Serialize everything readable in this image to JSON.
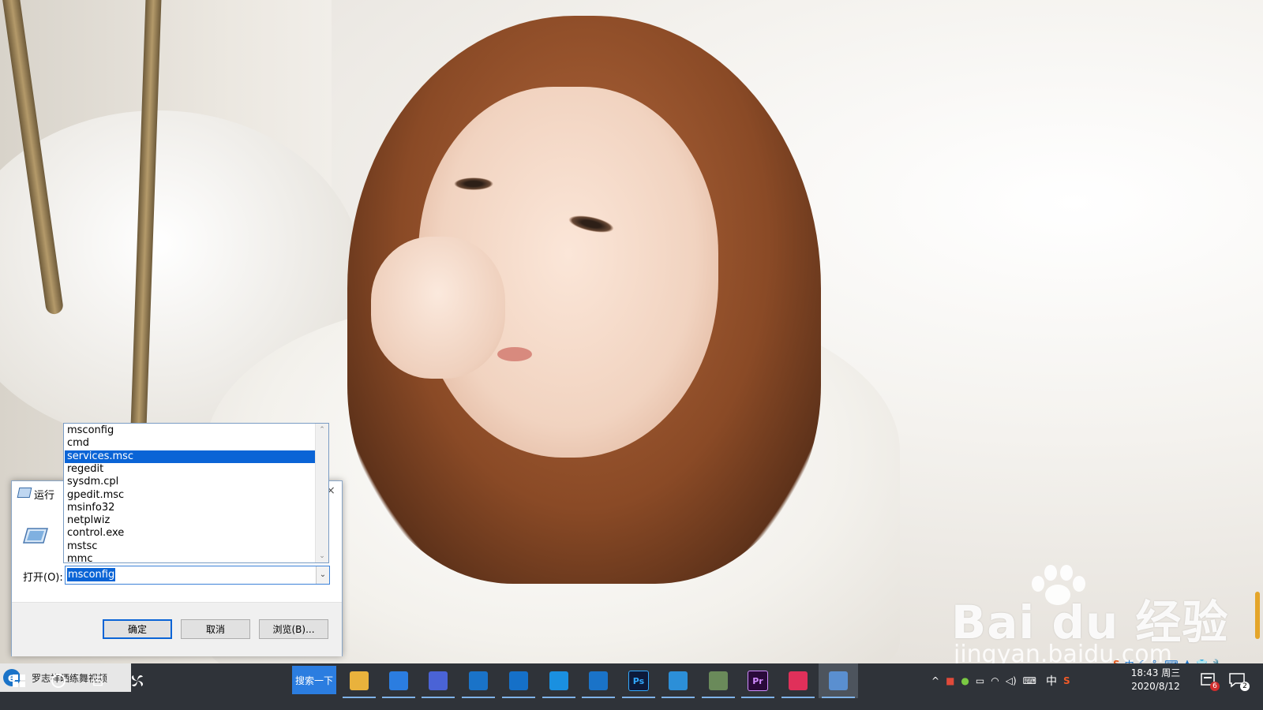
{
  "run_dialog": {
    "title": "运行",
    "close_glyph": "×",
    "open_label": "打开(O):",
    "input_value": "msconfig",
    "combo_arrow": "⌄",
    "ok_label": "确定",
    "cancel_label": "取消",
    "browse_label": "浏览(B)...",
    "icon": "run-icon"
  },
  "history": {
    "items": [
      "msconfig",
      "cmd",
      "services.msc",
      "regedit",
      "sysdm.cpl",
      "gpedit.msc",
      "msinfo32",
      "netplwiz",
      "control.exe",
      "mstsc",
      "mmc"
    ],
    "selected": "services.msc",
    "scroll_up": "⌃",
    "scroll_down": "⌄"
  },
  "taskbar": {
    "search_text": "罗志祥晒练舞视频",
    "search_button": "搜索一下",
    "taskview_glyph": "⊟",
    "apps": [
      {
        "name": "file-explorer-icon",
        "color": "#e9b23c"
      },
      {
        "name": "store-icon",
        "color": "#2b7de0"
      },
      {
        "name": "feishu-icon",
        "color": "#4a63d6"
      },
      {
        "name": "edge-icon",
        "color": "#1a73c8"
      },
      {
        "name": "calendar-app-icon",
        "color": "#1570c8"
      },
      {
        "name": "qq-browser-icon",
        "color": "#1a90e0"
      },
      {
        "name": "upload-app-icon",
        "color": "#1a73c8"
      },
      {
        "name": "photoshop-icon",
        "color": "#0d1a3a"
      },
      {
        "name": "outlook-icon",
        "color": "#2c8fd8"
      },
      {
        "name": "avatar-app-icon",
        "color": "#6a8a5a"
      },
      {
        "name": "premiere-icon",
        "color": "#2a0a3a"
      },
      {
        "name": "video-app-icon",
        "color": "#e0305a"
      },
      {
        "name": "run-app-icon",
        "color": "#5a8fd0"
      }
    ],
    "ps_label": "Ps",
    "pr_label": "Pr",
    "tray_caret": "^",
    "tray_ime": "中",
    "clock_time": "18:43 周三",
    "clock_date": "2020/8/12",
    "notify_badge": "6",
    "action_badge": "2"
  },
  "watermark": {
    "brand": "Bai du 经验",
    "sub": "jingyan.baidu.com"
  },
  "ime_bar": {
    "mode": "中"
  }
}
